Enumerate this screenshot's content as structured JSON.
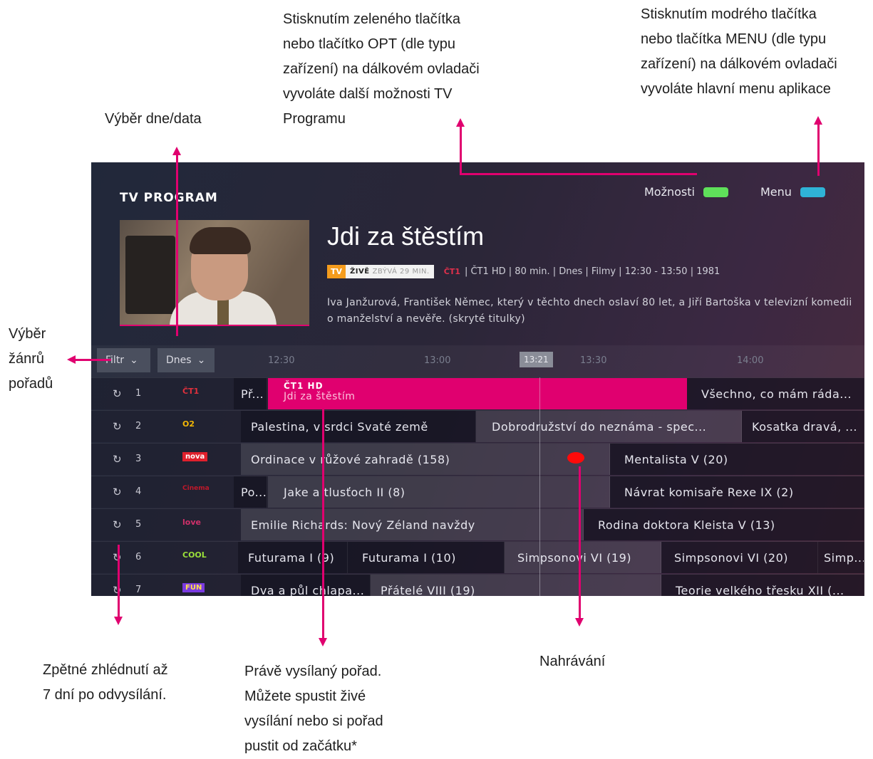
{
  "annotations": {
    "date_select": "Výběr dne/data",
    "options_lines": [
      "Stisknutím zeleného tlačítka",
      "nebo tlačítko OPT (dle typu",
      "zařízení) na dálkovém ovladači",
      "vyvoláte další možnosti TV",
      "Programu"
    ],
    "menu_lines": [
      "Stisknutím modrého tlačítka",
      "nebo tlačítka MENU (dle typu",
      "zařízení) na dálkovém ovladači",
      "vyvoláte hlavní menu aplikace"
    ],
    "genre_lines": [
      "Výběr",
      "žánrů",
      "pořadů"
    ],
    "replay_lines": [
      "Zpětné zhlédnutí až",
      "7 dní po odvysílání."
    ],
    "current_lines": [
      "Právě vysílaný pořad.",
      "Můžete spustit živé",
      "vysílání nebo si pořad",
      "pustit od začátku*"
    ],
    "recording": "Nahrávání"
  },
  "header": {
    "title": "TV PROGRAM",
    "options_label": "Možnosti",
    "menu_label": "Menu",
    "options_color": "#5fe05a",
    "menu_color": "#2fb3d6"
  },
  "detail": {
    "show_title": "Jdi za štěstím",
    "tv_badge": "TV",
    "live_label": "ŽIVĚ",
    "remaining_label": "ZBÝVÁ 29 MIN.",
    "meta": "| ČT1 HD | 80 min. | Dnes | Filmy | 12:30 - 13:50 | 1981",
    "description": "Iva Janžurová, František Němec, který v těchto dnech oslaví 80 let, a Jiří Bartoška v televizní komedii o manželství a nevěře. (skryté titulky)"
  },
  "timeline": {
    "filter_label": "Filtr",
    "day_label": "Dnes",
    "ticks": [
      "12:30",
      "13:00",
      "13:30",
      "14:00"
    ],
    "now": "13:21"
  },
  "channels": [
    {
      "num": "1",
      "logo": "ČT1",
      "logo_color": "#e0303c",
      "programs": [
        "Př...",
        "Všechno, co mám ráda..."
      ],
      "current": {
        "channel": "ČT1 HD",
        "title": "Jdi za štěstím"
      }
    },
    {
      "num": "2",
      "logo": "O2",
      "logo_color": "#f2b705",
      "programs": [
        "Palestina, v srdci Svaté země",
        "Dobrodružství do neznáma - spec...",
        "Kosatka dravá, ..."
      ]
    },
    {
      "num": "3",
      "logo": "nova",
      "logo_color": "#e0202c",
      "programs": [
        "Ordinace v růžové zahradě (158)",
        "Mentalista V (20)"
      ]
    },
    {
      "num": "4",
      "logo": "Cinema",
      "logo_color": "#c0182a",
      "programs": [
        "Po...",
        "Jake a tlusťoch II (8)",
        "Návrat komisaře Rexe IX (2)"
      ]
    },
    {
      "num": "5",
      "logo": "love",
      "logo_color": "#d0306a",
      "programs": [
        "Emilie Richards: Nový Zéland navždy",
        "Rodina doktora Kleista V (13)"
      ]
    },
    {
      "num": "6",
      "logo": "COOL",
      "logo_color": "#9be03a",
      "programs": [
        "Futurama I (9)",
        "Futurama I (10)",
        "Simpsonovi VI (19)",
        "Simpsonovi VI (20)",
        "Simp..."
      ]
    },
    {
      "num": "7",
      "logo": "FUN",
      "logo_color": "#7a3ae0",
      "programs": [
        "Dva a půl chlapa...",
        "Přátelé VIII (19)",
        "Teorie velkého třesku XII (..."
      ]
    }
  ]
}
